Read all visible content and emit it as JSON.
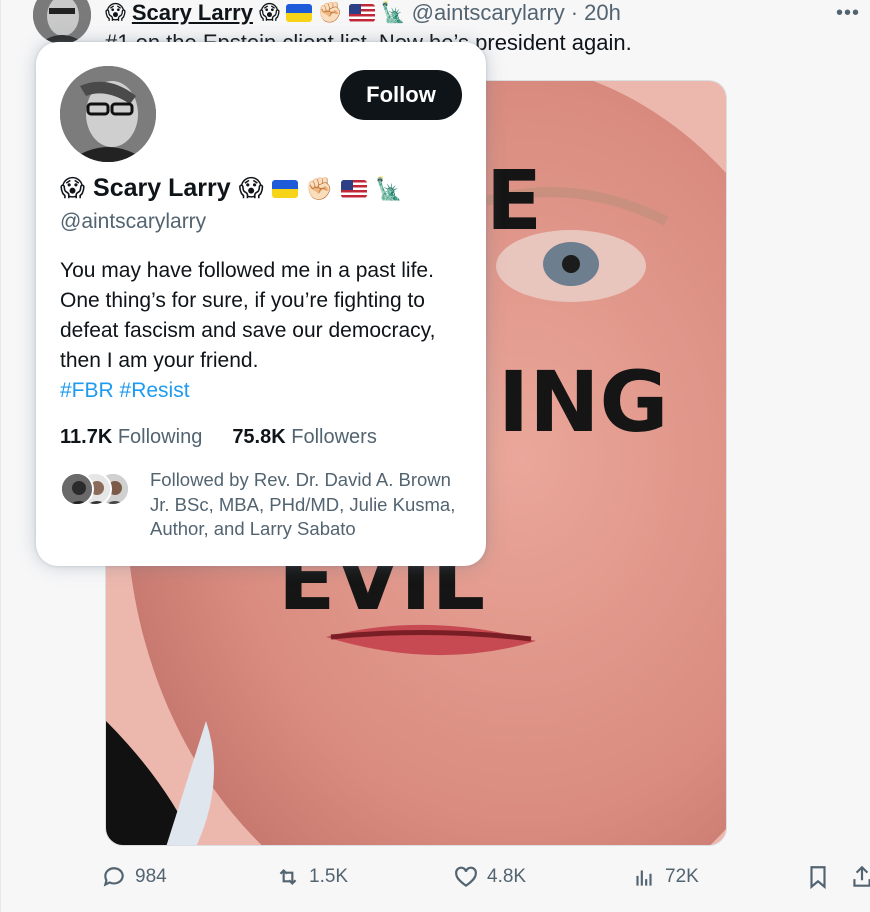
{
  "tweet": {
    "display_name": "Scary Larry",
    "handle": "@aintscarylarry",
    "separator": "·",
    "time": "20h",
    "text": "#1 on the Epstein client list. Now he’s president again.",
    "image_words": [
      "E",
      "ING",
      "EVIL"
    ],
    "more_icon": "more-dots-icon",
    "actions": {
      "replies": "984",
      "reposts": "1.5K",
      "likes": "4.8K",
      "views": "72K"
    }
  },
  "hover_card": {
    "display_name": "Scary Larry",
    "handle": "@aintscarylarry",
    "follow_label": "Follow",
    "bio_text": "You may have followed me in a past life. One thing’s for sure, if you’re fighting to defeat fascism and save our democracy, then I am your friend.",
    "bio_tags": [
      "#FBR",
      "#Resist"
    ],
    "following_count": "11.7K",
    "following_label": "Following",
    "followers_count": "75.8K",
    "followers_label": "Followers",
    "followed_by": "Followed by Rev. Dr. David A. Brown Jr. BSc, MBA, PHd/MD, Julie Kusma, Author, and Larry Sabato"
  },
  "name_emojis": [
    "😱",
    "😱",
    "✊🏻",
    "🗽"
  ],
  "colors": {
    "link_blue": "#1d9bf0",
    "text_primary": "#0f1419",
    "text_secondary": "#536471",
    "button_dark": "#0f1419"
  }
}
